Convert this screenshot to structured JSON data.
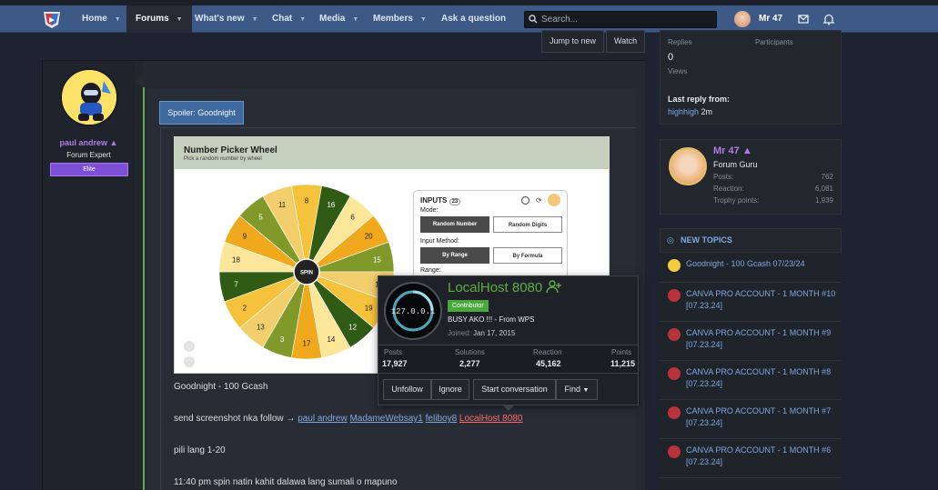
{
  "nav": {
    "items": [
      {
        "label": "Home"
      },
      {
        "label": "Forums"
      },
      {
        "label": "What's new"
      },
      {
        "label": "Chat"
      },
      {
        "label": "Media"
      },
      {
        "label": "Members"
      },
      {
        "label": "Ask a question"
      }
    ],
    "search_placeholder": "Search...",
    "user": "Mr 47"
  },
  "thread_actions": {
    "jump": "Jump to new",
    "watch": "Watch"
  },
  "poster": {
    "name": "paul andrew",
    "title": "Forum Expert",
    "badge": "Elite"
  },
  "post": {
    "spoiler_label": "Spoiler: Goodnight",
    "wheel": {
      "title": "Number Picker Wheel",
      "subtitle": "Pick a random number by wheel",
      "spin_label": "SPIN",
      "numbers": [
        "8",
        "16",
        "6",
        "20",
        "15",
        "1",
        "19",
        "12",
        "14",
        "17",
        "3",
        "13",
        "2",
        "7",
        "18",
        "9",
        "5",
        "11"
      ],
      "panel": {
        "inputs_label": "INPUTS",
        "inputs_count": "23",
        "mode_label": "Mode:",
        "random_number": "Random Number",
        "random_digits": "Random Digits",
        "input_method_label": "Input Method:",
        "by_range": "By Range",
        "by_formula": "By Formula",
        "range_label": "Range:"
      }
    },
    "line1": "Goodnight - 100 Gcash",
    "line2_prefix": "send screenshot nka follow →",
    "mentions": [
      "paul andrew",
      "MadameWebsay1",
      "feliboy8",
      "LocalHost 8080"
    ],
    "line3": "pili lang 1-20",
    "line4": "11:40 pm spin natin kahit dalawa lang sumali o mapuno"
  },
  "popup": {
    "name": "LocalHost 8080",
    "avatar_text": "127.0.0.1",
    "badge": "Contributor",
    "status": "BUSY AKO !!! - From WPS",
    "joined_label": "Joined:",
    "joined_date": "Jan 17, 2015",
    "stats": [
      {
        "label": "Posts",
        "value": "17,927"
      },
      {
        "label": "Solutions",
        "value": "2,277"
      },
      {
        "label": "Reaction",
        "value": "45,162"
      },
      {
        "label": "Points",
        "value": "11,215"
      }
    ],
    "buttons": [
      "Unfollow",
      "Ignore",
      "Start conversation",
      "Find"
    ]
  },
  "thread_info": {
    "replies_label": "Replies",
    "participants_label": "Participants",
    "views_value": "0",
    "views_label": "Views",
    "last_reply_label": "Last reply from:",
    "last_reply_user": "highhigh",
    "last_reply_time": "2m"
  },
  "member_card": {
    "name": "Mr 47",
    "title": "Forum Guru",
    "posts_label": "Posts:",
    "posts": "762",
    "reaction_label": "Reaction:",
    "reaction": "6,081",
    "trophy_label": "Trophy points:",
    "trophy": "1,939"
  },
  "new_topics": {
    "heading": "NEW TOPICS",
    "items": [
      "Goodnight - 100 Gcash 07/23/24",
      "CANVA PRO ACCOUNT - 1 MONTH #10 [07.23.24]",
      "CANVA PRO ACCOUNT - 1 MONTH #9 [07.23.24]",
      "CANVA PRO ACCOUNT - 1 MONTH #8 [07.23.24]",
      "CANVA PRO ACCOUNT - 1 MONTH #7 [07.23.24]",
      "CANVA PRO ACCOUNT - 1 MONTH #6 [07.23.24]"
    ]
  },
  "colors": {
    "accent_blue": "#3d5a86",
    "green": "#5cae41",
    "purple": "#b07de3",
    "link": "#7fa8e0"
  }
}
